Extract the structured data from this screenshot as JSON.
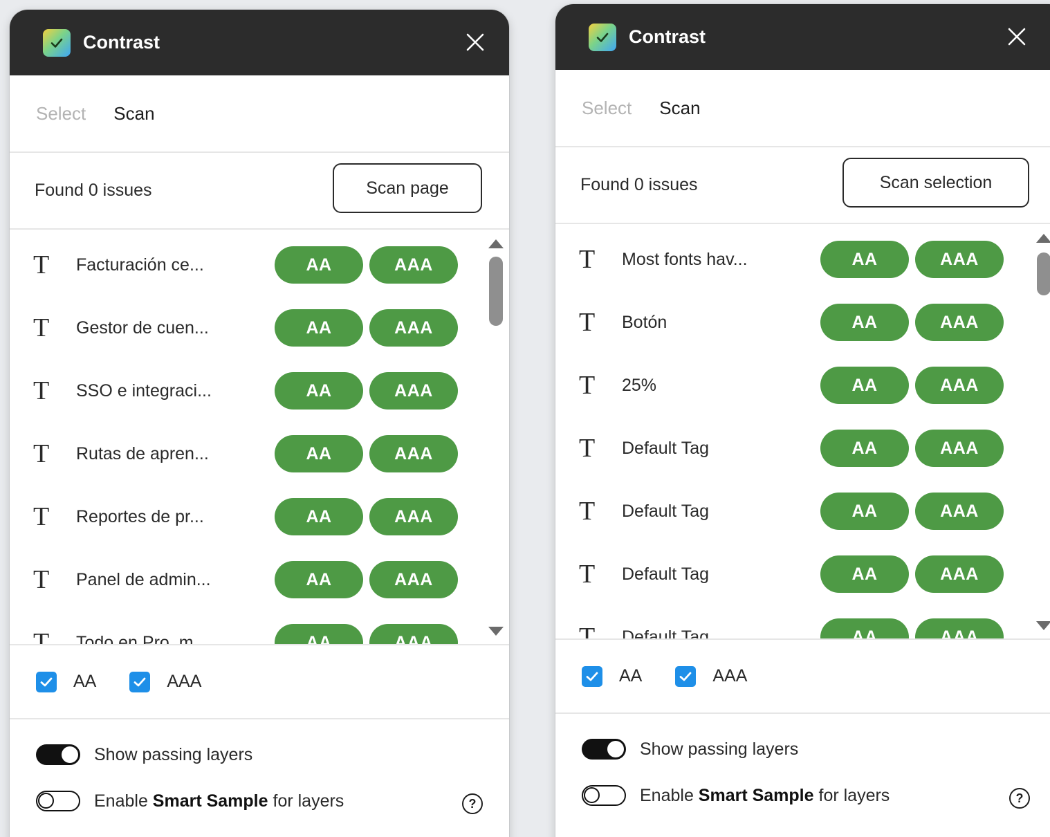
{
  "colors": {
    "titlebar": "#2c2c2c",
    "pill_pass": "#4e9a45",
    "checkbox": "#1e8fe8",
    "background": "#e9ebee"
  },
  "left": {
    "title": "Contrast",
    "tabs": [
      "Select",
      "Scan"
    ],
    "active_tab": "Scan",
    "found_text": "Found 0 issues",
    "scan_button": "Scan page",
    "rows": [
      {
        "label": "Facturación ce...",
        "aa": "AA",
        "aaa": "AAA"
      },
      {
        "label": "Gestor de cuen...",
        "aa": "AA",
        "aaa": "AAA"
      },
      {
        "label": "SSO e integraci...",
        "aa": "AA",
        "aaa": "AAA"
      },
      {
        "label": "Rutas de apren...",
        "aa": "AA",
        "aaa": "AAA"
      },
      {
        "label": "Reportes de pr...",
        "aa": "AA",
        "aaa": "AAA"
      },
      {
        "label": "Panel de admin...",
        "aa": "AA",
        "aaa": "AAA"
      },
      {
        "label": "Todo en Pro, m...",
        "aa": "AA",
        "aaa": "AAA"
      }
    ],
    "levels": [
      "AA",
      "AAA"
    ],
    "options": {
      "show_passing": "Show passing layers",
      "smart_sample_prefix": "Enable ",
      "smart_sample_bold": "Smart Sample",
      "smart_sample_suffix": " for layers"
    },
    "help": "?"
  },
  "right": {
    "title": "Contrast",
    "tabs": [
      "Select",
      "Scan"
    ],
    "active_tab": "Scan",
    "found_text": "Found 0 issues",
    "scan_button": "Scan selection",
    "rows": [
      {
        "label": "Most fonts hav...",
        "aa": "AA",
        "aaa": "AAA"
      },
      {
        "label": "Botón",
        "aa": "AA",
        "aaa": "AAA"
      },
      {
        "label": "25%",
        "aa": "AA",
        "aaa": "AAA"
      },
      {
        "label": "Default Tag",
        "aa": "AA",
        "aaa": "AAA"
      },
      {
        "label": "Default Tag",
        "aa": "AA",
        "aaa": "AAA"
      },
      {
        "label": "Default Tag",
        "aa": "AA",
        "aaa": "AAA"
      },
      {
        "label": "Default Tag",
        "aa": "AA",
        "aaa": "AAA"
      }
    ],
    "levels": [
      "AA",
      "AAA"
    ],
    "options": {
      "show_passing": "Show passing layers",
      "smart_sample_prefix": "Enable ",
      "smart_sample_bold": "Smart Sample",
      "smart_sample_suffix": " for layers"
    },
    "help": "?"
  }
}
